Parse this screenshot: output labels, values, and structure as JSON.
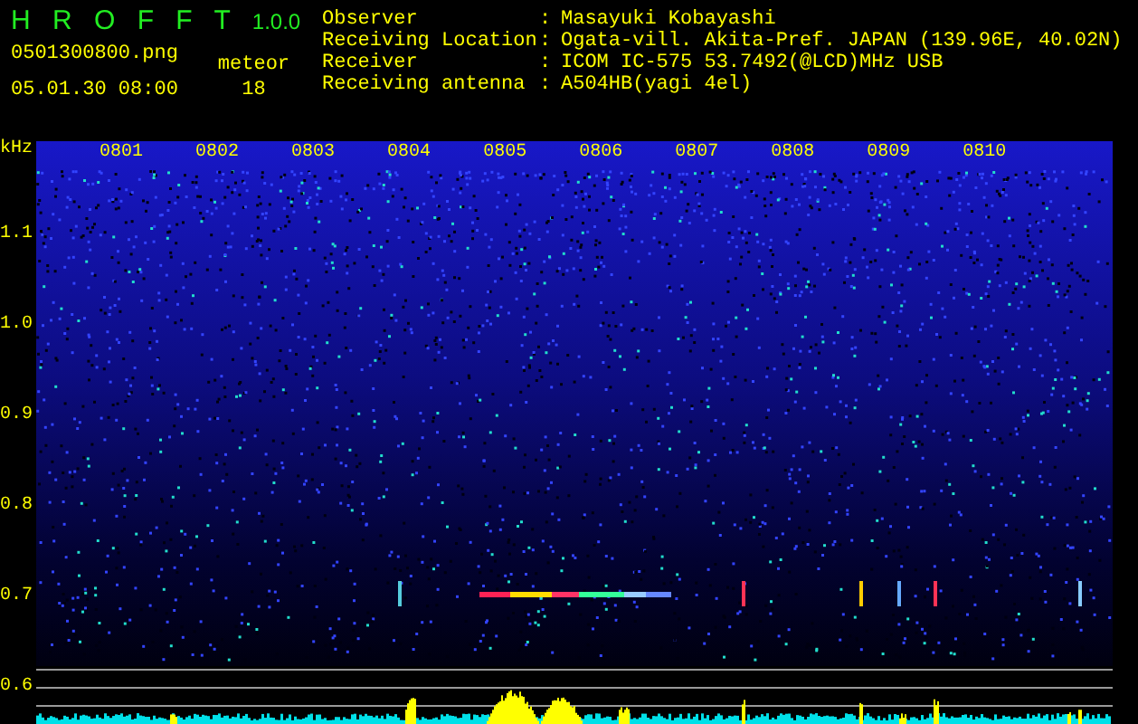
{
  "app": {
    "name": "H R O F F T",
    "version": "1.0.0"
  },
  "file": "0501300800.png",
  "datetime": "05.01.30 08:00",
  "meteor": {
    "label": "meteor",
    "count": "18"
  },
  "station": [
    {
      "label": "Observer",
      "colon": ":",
      "value": "Masayuki Kobayashi"
    },
    {
      "label": "Receiving Location",
      "colon": ":",
      "value": "Ogata-vill. Akita-Pref. JAPAN (139.96E, 40.02N)"
    },
    {
      "label": "Receiver",
      "colon": ":",
      "value": "ICOM IC-575 53.7492(@LCD)MHz USB"
    },
    {
      "label": "Receiving antenna",
      "colon": ":",
      "value": "A504HB(yagi 4el)"
    }
  ],
  "y_axis": {
    "unit": "kHz",
    "labels": [
      "1.1",
      "1.0",
      "0.9",
      "0.8",
      "0.7",
      "0.6"
    ]
  },
  "time_labels": [
    "0801",
    "0802",
    "0803",
    "0804",
    "0805",
    "0806",
    "0807",
    "0808",
    "0809",
    "0810"
  ]
}
